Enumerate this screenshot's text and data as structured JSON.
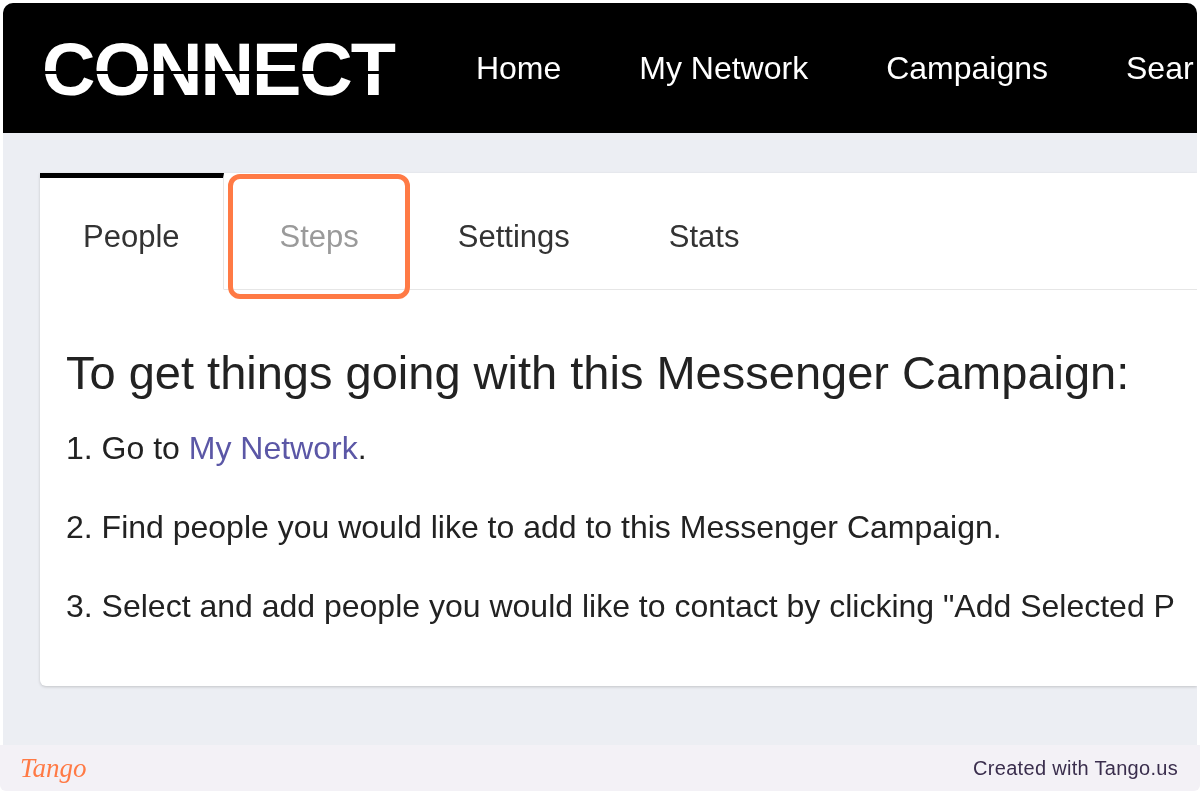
{
  "header": {
    "logo": "CONNECT",
    "nav": [
      {
        "label": "Home"
      },
      {
        "label": "My Network"
      },
      {
        "label": "Campaigns"
      },
      {
        "label": "Sear"
      }
    ]
  },
  "tabs": [
    {
      "label": "People",
      "selected": true,
      "disabled": false,
      "highlighted": false
    },
    {
      "label": "Steps",
      "selected": false,
      "disabled": true,
      "highlighted": true
    },
    {
      "label": "Settings",
      "selected": false,
      "disabled": false,
      "highlighted": false
    },
    {
      "label": "Stats",
      "selected": false,
      "disabled": false,
      "highlighted": false
    }
  ],
  "panel": {
    "heading": "To get things going with this Messenger Campaign:",
    "steps": [
      {
        "kind": "link",
        "before": "1. Go to ",
        "link": "My Network",
        "after": "."
      },
      {
        "kind": "plain",
        "text": "2. Find people you would like to add to this Messenger Campaign."
      },
      {
        "kind": "plain",
        "text": "3. Select and add people you would like to contact by clicking \"Add Selected P"
      }
    ]
  },
  "footer": {
    "logo": "Tango",
    "credit": "Created with Tango.us"
  }
}
